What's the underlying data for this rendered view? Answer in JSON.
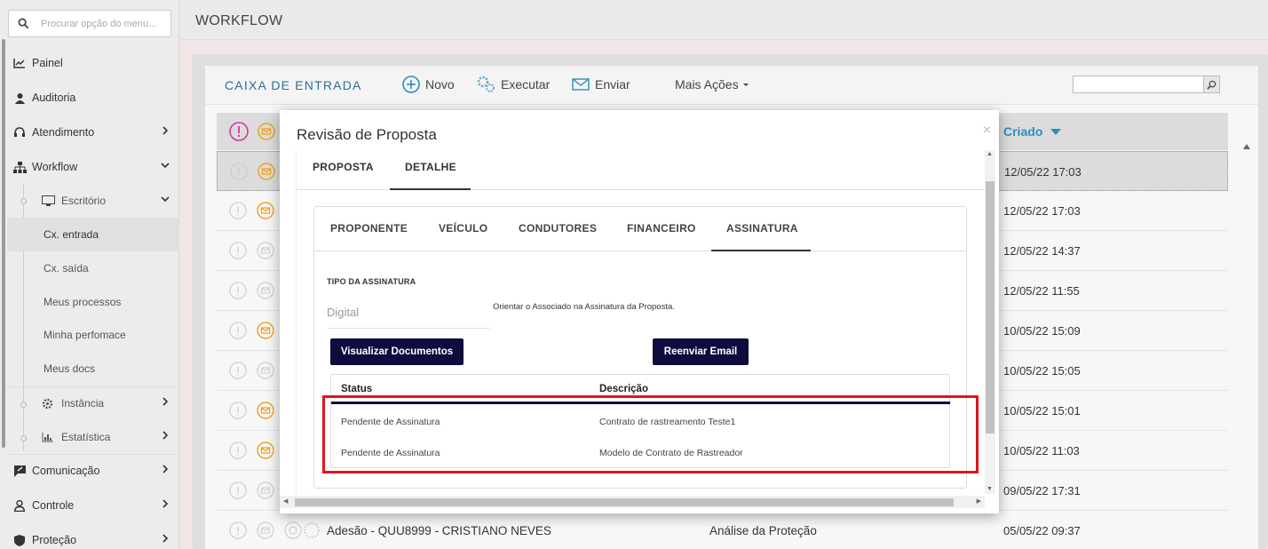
{
  "sidebar": {
    "search_placeholder": "Procurar opção do menu...",
    "items": [
      {
        "label": "Painel"
      },
      {
        "label": "Auditoria"
      },
      {
        "label": "Atendimento"
      },
      {
        "label": "Workflow"
      },
      {
        "label": "Comunicação"
      },
      {
        "label": "Controle"
      },
      {
        "label": "Proteção"
      }
    ],
    "workflow_sub": {
      "escritorio": "Escritório",
      "entries": [
        "Cx. entrada",
        "Cx. saída",
        "Meus processos",
        "Minha perfomace",
        "Meus docs"
      ],
      "instancia": "Instância",
      "estatistica": "Estatística"
    }
  },
  "topbar": {
    "title": "WORKFLOW"
  },
  "inbox": {
    "title": "CAIXA DE ENTRADA",
    "toolbar": {
      "novo": "Novo",
      "executar": "Executar",
      "enviar": "Enviar",
      "mais": "Mais Ações"
    },
    "created_header": "Criado",
    "rows": [
      {
        "date": "12/05/22 17:03"
      },
      {
        "date": "12/05/22 17:03"
      },
      {
        "date": "12/05/22 14:37"
      },
      {
        "date": "12/05/22 11:55"
      },
      {
        "date": "10/05/22 15:09"
      },
      {
        "date": "10/05/22 15:05"
      },
      {
        "date": "10/05/22 15:01"
      },
      {
        "date": "10/05/22 11:03"
      },
      {
        "date": "09/05/22 17:31"
      },
      {
        "date": "05/05/22 09:37",
        "desc": "Adesão - QUU8999 - CRISTIANO NEVES",
        "step": "Análise da Proteção"
      }
    ]
  },
  "modal": {
    "title": "Revisão de Proposta",
    "close": "×",
    "tabs": [
      "PROPOSTA",
      "DETALHE"
    ],
    "subtabs": [
      "PROPONENTE",
      "VEÍCULO",
      "CONDUTORES",
      "FINANCEIRO",
      "ASSINATURA"
    ],
    "tipo_label": "TIPO DA ASSINATURA",
    "tipo_value": "Digital",
    "hint": "Orientar o Associado na Assinatura da Proposta.",
    "btn_docs": "Visualizar Documentos",
    "btn_email": "Reenviar Email",
    "table": {
      "headers": [
        "Status",
        "Descrição"
      ],
      "rows": [
        {
          "status": "Pendente de Assinatura",
          "descricao": "Contrato de rastreamento Teste1"
        },
        {
          "status": "Pendente de Assinatura",
          "descricao": "Modelo de Contrato de Rastreador"
        }
      ]
    }
  },
  "colors": {
    "accent": "#2b8fbe",
    "dark_button": "#0c0c3e",
    "highlight": "#e0141e",
    "orange_icon": "#f0a020"
  }
}
